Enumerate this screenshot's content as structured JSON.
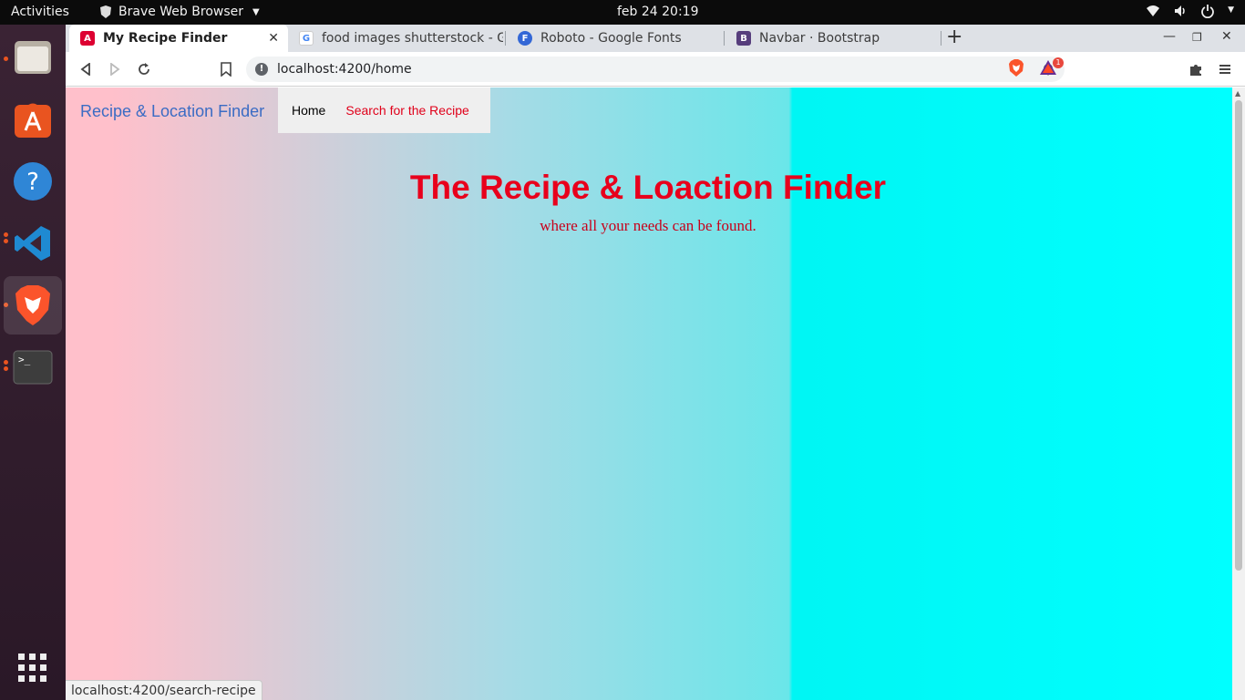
{
  "system": {
    "activities": "Activities",
    "app_name": "Brave Web Browser",
    "clock": "feb 24  20:19"
  },
  "dock": {
    "items": [
      "files-icon",
      "app-store-icon",
      "help-icon",
      "vscode-icon",
      "brave-icon",
      "terminal-icon",
      "show-apps-icon"
    ]
  },
  "browser": {
    "tabs": [
      {
        "title": "My Recipe Finder",
        "favicon": "angular-icon",
        "active": true
      },
      {
        "title": "food images shutterstock - Go",
        "favicon": "google-icon",
        "active": false
      },
      {
        "title": "Roboto - Google Fonts",
        "favicon": "google-fonts-icon",
        "active": false
      },
      {
        "title": "Navbar · Bootstrap",
        "favicon": "bootstrap-icon",
        "active": false
      }
    ],
    "url": "localhost:4200/home",
    "rewards_badge": "1",
    "status_url": "localhost:4200/search-recipe"
  },
  "page": {
    "brand": "Recipe & Location Finder",
    "nav": {
      "home": "Home",
      "search": "Search for the Recipe"
    },
    "title": "The Recipe & Loaction Finder",
    "subtitle": "where all your needs can be found."
  },
  "colors": {
    "title_red": "#e8001c",
    "brand_blue": "#3b6cc4",
    "gradient_start": "#ffc0cb",
    "gradient_end": "#00ffff"
  }
}
